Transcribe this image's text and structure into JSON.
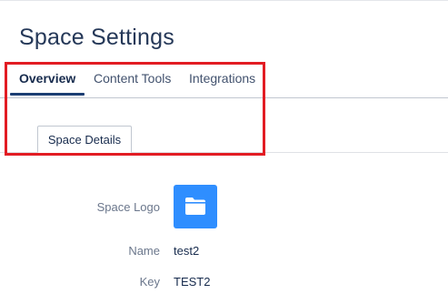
{
  "header": {
    "title": "Space Settings"
  },
  "tabs": [
    {
      "label": "Overview",
      "active": true
    },
    {
      "label": "Content Tools",
      "active": false
    },
    {
      "label": "Integrations",
      "active": false
    }
  ],
  "subtabs": [
    {
      "label": "Space Details",
      "active": true
    }
  ],
  "details": {
    "logo": {
      "label": "Space Logo",
      "icon": "folder-icon"
    },
    "name": {
      "label": "Name",
      "value": "test2"
    },
    "key": {
      "label": "Key",
      "value": "TEST2"
    }
  },
  "colors": {
    "highlight": "#e21c23",
    "active_tab_underline": "#1c3e73",
    "logo_background": "#2f8eff"
  }
}
